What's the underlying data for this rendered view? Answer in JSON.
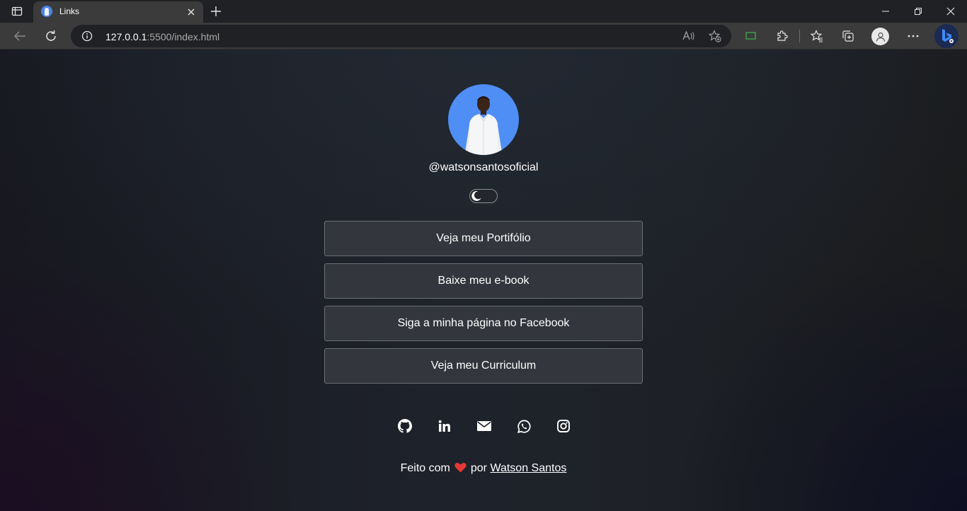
{
  "browser": {
    "tab": {
      "title": "Links"
    },
    "address": {
      "host": "127.0.0.1",
      "path": ":5500/index.html"
    },
    "icons": {
      "tab_actions": "tab-actions-icon",
      "close_tab": "close-icon",
      "new_tab": "plus-icon",
      "back": "back-arrow-icon",
      "refresh": "refresh-icon",
      "site_info": "info-icon",
      "read_aloud": "read-aloud-icon",
      "add_favorite": "star-plus-icon",
      "extensions": "puzzle-icon",
      "favorites": "favorites-icon",
      "collections": "collections-icon",
      "profile": "profile-icon",
      "settings": "more-icon",
      "bing": "bing-icon"
    }
  },
  "profile": {
    "username": "@watsonsantosoficial",
    "avatar_color": "#4e8ef5"
  },
  "theme_toggle": {
    "icon": "moon-icon",
    "state": "dark"
  },
  "links": [
    {
      "label": "Veja meu Portifólio"
    },
    {
      "label": "Baixe meu e-book"
    },
    {
      "label": "Siga a minha página no Facebook"
    },
    {
      "label": "Veja meu Curriculum"
    }
  ],
  "socials": [
    "github-icon",
    "linkedin-icon",
    "email-icon",
    "whatsapp-icon",
    "instagram-icon"
  ],
  "footer": {
    "prefix": "Feito com",
    "middle": "por",
    "author": "Watson Santos",
    "heart_color": "#e53935"
  },
  "colors": {
    "page_bg": "#1e222a",
    "button_bg": "#33363c",
    "button_border": "#6c6f74",
    "text": "#ffffff"
  }
}
